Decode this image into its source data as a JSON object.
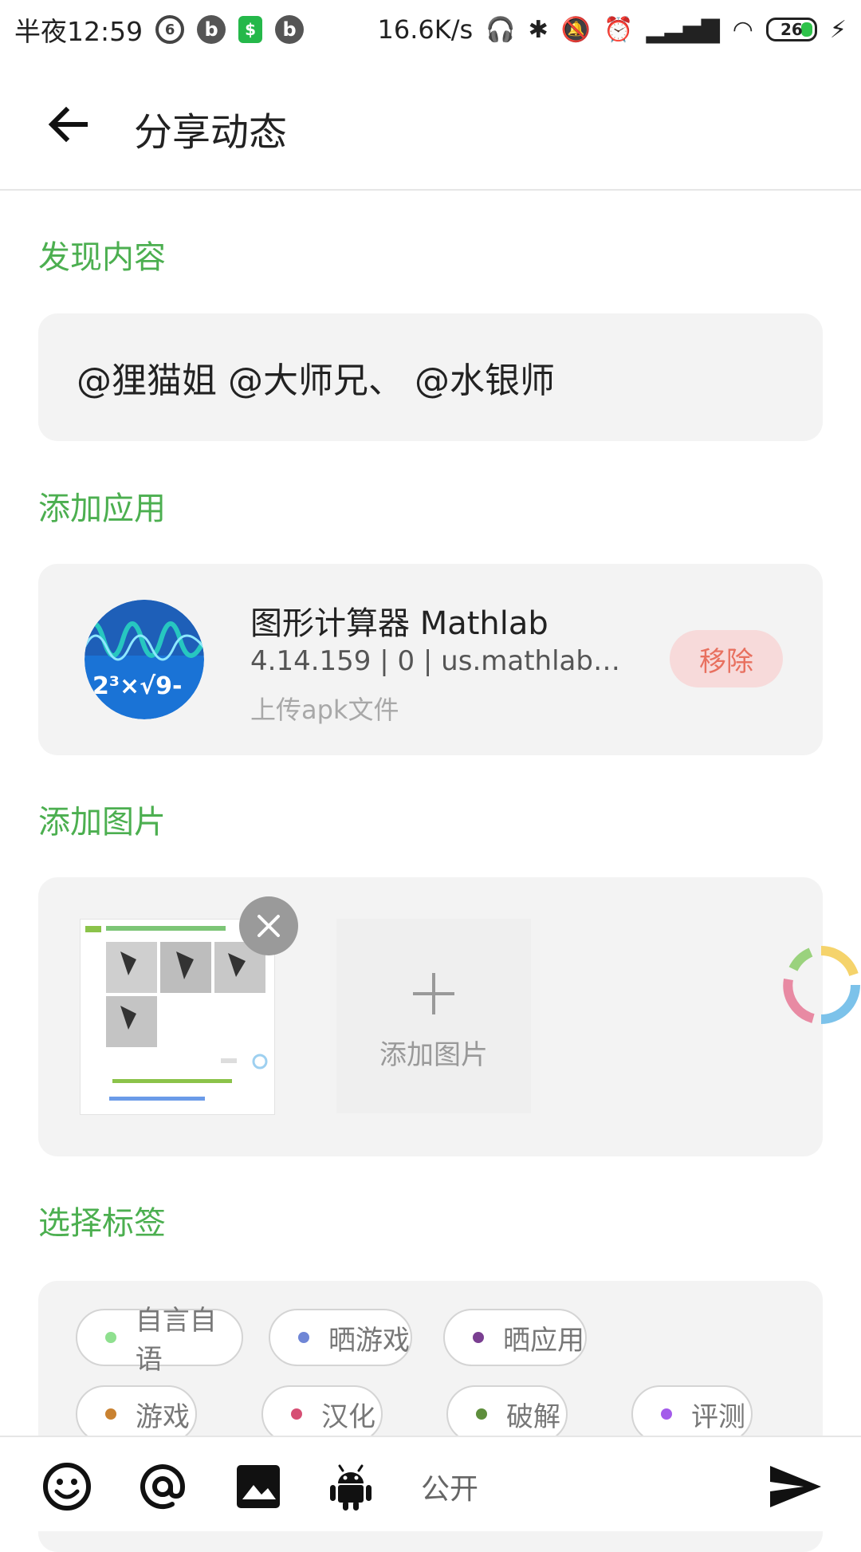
{
  "status_bar": {
    "time": "半夜12:59",
    "speed": "16.6K/s",
    "battery": "26"
  },
  "header": {
    "title": "分享动态"
  },
  "discover": {
    "title": "发现内容",
    "mentions": "@狸猫姐 @大师兄、 @水银师"
  },
  "add_app": {
    "title": "添加应用",
    "name": "图形计算器 Mathlab",
    "meta": "4.14.159 | 0 | us.mathlab.android",
    "upload": "上传apk文件",
    "remove_label": "移除"
  },
  "add_image": {
    "title": "添加图片",
    "add_label": "添加图片"
  },
  "tags": {
    "title": "选择标签",
    "items": [
      {
        "label": "自言自语",
        "color": "#8fe08f"
      },
      {
        "label": "晒游戏",
        "color": "#6f86d6"
      },
      {
        "label": "晒应用",
        "color": "#7a3f91"
      },
      {
        "label": "游戏",
        "color": "#c98231"
      },
      {
        "label": "汉化",
        "color": "#d64f74"
      },
      {
        "label": "破解",
        "color": "#5e8e3c"
      },
      {
        "label": "评测",
        "color": "#a35bea"
      }
    ]
  },
  "bottom_bar": {
    "privacy": "公开"
  },
  "colors": {
    "accent": "#4caf50",
    "remove_text": "#e8705f",
    "remove_bg": "#f7dada"
  }
}
